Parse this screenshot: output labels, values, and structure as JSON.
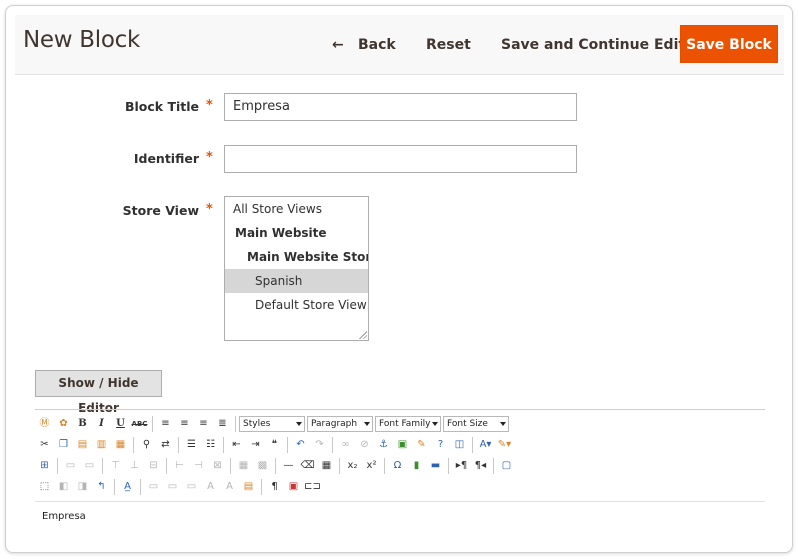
{
  "header": {
    "title": "New Block",
    "back_label": "Back",
    "back_arrow": "←",
    "reset_label": "Reset",
    "save_continue_label": "Save and Continue Edit",
    "save_label": "Save Block"
  },
  "form": {
    "required_mark": "*",
    "block_title": {
      "label": "Block Title",
      "value": "Empresa"
    },
    "identifier": {
      "label": "Identifier",
      "value": ""
    },
    "store_view": {
      "label": "Store View",
      "options": [
        {
          "label": "All Store Views",
          "level": 0,
          "bold": false,
          "selected": false
        },
        {
          "label": "Main Website",
          "level": 1,
          "bold": true,
          "selected": false
        },
        {
          "label": "Main Website Store",
          "level": 2,
          "bold": true,
          "selected": false
        },
        {
          "label": "Spanish",
          "level": 3,
          "bold": false,
          "selected": true
        },
        {
          "label": "Default Store View",
          "level": 3,
          "bold": false,
          "selected": false
        }
      ]
    }
  },
  "editor": {
    "toggle_label": "Show / Hide Editor",
    "styles_select": "Styles",
    "paragraph_select": "Paragraph",
    "font_family_select": "Font Family",
    "font_size_select": "Font Size",
    "content": "Empresa"
  }
}
